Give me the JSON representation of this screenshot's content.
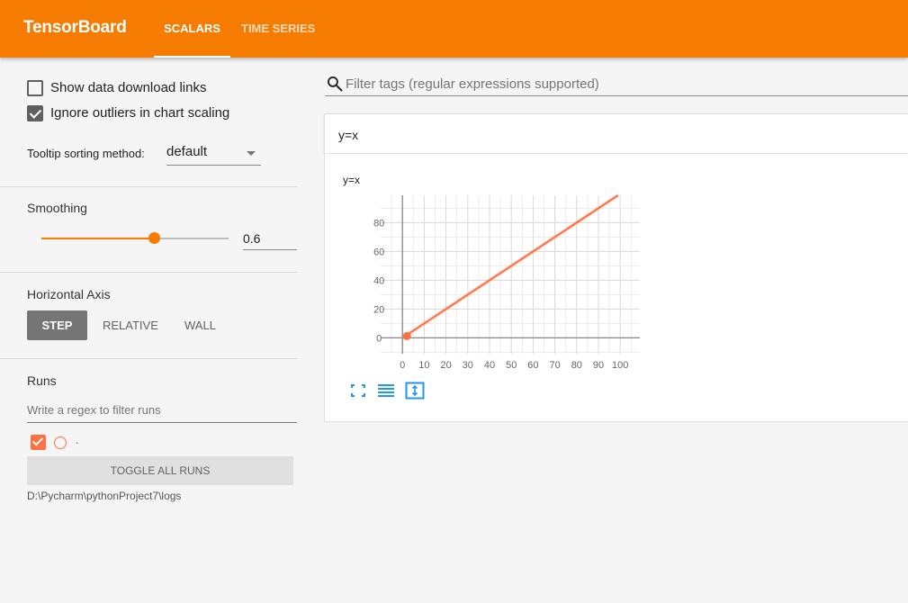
{
  "header": {
    "brand": "TensorBoard",
    "tabs": [
      {
        "label": "SCALARS",
        "active": true
      },
      {
        "label": "TIME SERIES",
        "active": false
      }
    ]
  },
  "sidebar": {
    "show_download_links": {
      "label": "Show data download links",
      "checked": false
    },
    "ignore_outliers": {
      "label": "Ignore outliers in chart scaling",
      "checked": true
    },
    "tooltip_sorting": {
      "label": "Tooltip sorting method:",
      "value": "default"
    },
    "smoothing": {
      "title": "Smoothing",
      "value": "0.6",
      "fraction": 0.6
    },
    "horizontal_axis": {
      "title": "Horizontal Axis",
      "options": [
        {
          "label": "STEP",
          "selected": true
        },
        {
          "label": "RELATIVE",
          "selected": false
        },
        {
          "label": "WALL",
          "selected": false
        }
      ]
    },
    "runs": {
      "title": "Runs",
      "filter_placeholder": "Write a regex to filter runs",
      "items": [
        {
          "name": ".",
          "checked": true,
          "color": "#ff7043"
        }
      ],
      "toggle_all_label": "TOGGLE ALL RUNS",
      "logdir": "D:\\Pycharm\\pythonProject7\\logs"
    }
  },
  "main": {
    "filter_placeholder": "Filter tags (regular expressions supported)",
    "cards": [
      {
        "header": "y=x",
        "chart_title": "y=x",
        "tool_icons": [
          "fullscreen-icon",
          "log-scale-icon",
          "fit-domain-icon"
        ]
      }
    ]
  },
  "colors": {
    "accent": "#f57c00",
    "run": "#ff7043"
  },
  "chart_data": {
    "type": "line",
    "title": "y=x",
    "xlabel": "",
    "ylabel": "",
    "x_ticks": [
      0,
      10,
      20,
      30,
      40,
      50,
      60,
      70,
      80,
      90,
      100
    ],
    "y_ticks": [
      0,
      20,
      40,
      60,
      80
    ],
    "xlim": [
      -10,
      109
    ],
    "ylim": [
      -11,
      99
    ],
    "grid": true,
    "series": [
      {
        "name": ".",
        "color": "#ff7043",
        "x": [
          0,
          99
        ],
        "y": [
          0,
          99
        ]
      }
    ],
    "highlight_point": {
      "x": 0,
      "y": 0
    }
  }
}
